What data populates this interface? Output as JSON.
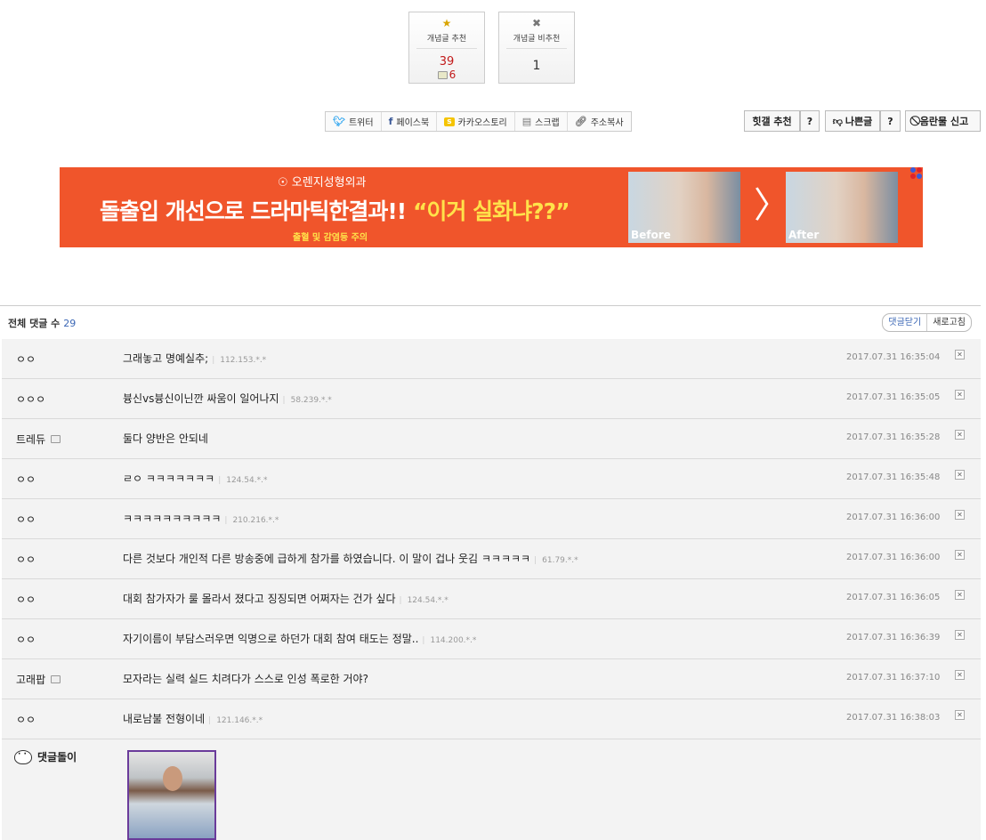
{
  "votes": {
    "up_label": "개념글 추천",
    "up_count": "39",
    "up_fixed_count": "6",
    "down_label": "개념글 비추천",
    "down_count": "1"
  },
  "share": {
    "twitter": "트위터",
    "facebook": "페이스북",
    "kakaostory": "카카오스토리",
    "scrap": "스크랩",
    "copy_url": "주소복사"
  },
  "actions": {
    "hit_recommend": "힛갤 추천",
    "help": "?",
    "bad_post": "나쁜글",
    "report": "음란물 신고"
  },
  "banner": {
    "brand": "오렌지성형외과",
    "headline_white": "돌출입 개선으로 드라마틱한결과!!",
    "headline_yellow": "“이거 실화냐??”",
    "note": "출혈 및 감염등 주의",
    "before_label": "Before",
    "after_label": "After",
    "arrow": "〉"
  },
  "comments_header": {
    "label": "전체 댓글 수",
    "count": "29",
    "close_btn": "댓글닫기",
    "refresh_btn": "새로고침"
  },
  "comments": [
    {
      "nick": "ㅇㅇ",
      "text": "그래놓고 명예실추;",
      "ip": "112.153.*.*",
      "time": "2017.07.31 16:35:04",
      "badge": false
    },
    {
      "nick": "ㅇㅇㅇ",
      "text": "븅신vs븅신이닌깐 싸움이 일어나지",
      "ip": "58.239.*.*",
      "time": "2017.07.31 16:35:05",
      "badge": false
    },
    {
      "nick": "트레듀",
      "text": "둘다 양반은 안되네",
      "ip": "",
      "time": "2017.07.31 16:35:28",
      "badge": true
    },
    {
      "nick": "ㅇㅇ",
      "text": "ㄹㅇ ㅋㅋㅋㅋㅋㅋㅋ",
      "ip": "124.54.*.*",
      "time": "2017.07.31 16:35:48",
      "badge": false
    },
    {
      "nick": "ㅇㅇ",
      "text": "ㅋㅋㅋㅋㅋㅋㅋㅋㅋㅋ",
      "ip": "210.216.*.*",
      "time": "2017.07.31 16:36:00",
      "badge": false
    },
    {
      "nick": "ㅇㅇ",
      "text": "다른 것보다 개인적 다른 방송중에 급하게 참가를 하였습니다. 이 말이 겁나 웃김 ㅋㅋㅋㅋㅋ",
      "ip": "61.79.*.*",
      "time": "2017.07.31 16:36:00",
      "badge": false
    },
    {
      "nick": "ㅇㅇ",
      "text": "대회 참가자가 룰 몰라서 졌다고 징징되면 어쩌자는 건가 싶다",
      "ip": "124.54.*.*",
      "time": "2017.07.31 16:36:05",
      "badge": false
    },
    {
      "nick": "ㅇㅇ",
      "text": "자기이름이 부담스러우면 익명으로 하던가 대회 참여 태도는 정말..",
      "ip": "114.200.*.*",
      "time": "2017.07.31 16:36:39",
      "badge": false
    },
    {
      "nick": "고래팝",
      "text": "모자라는 실력 실드 치려다가 스스로 인성 폭로한 거야?",
      "ip": "",
      "time": "2017.07.31 16:37:10",
      "badge": true
    },
    {
      "nick": "ㅇㅇ",
      "text": "내로남불 전형이네",
      "ip": "121.146.*.*",
      "time": "2017.07.31 16:38:03",
      "badge": false
    }
  ],
  "comment_bot": {
    "nick": "댓글돌이"
  },
  "colors": {
    "banner_bg": "#f0552b",
    "accent_blue": "#3b67b5",
    "vote_red": "#c21a1a"
  }
}
